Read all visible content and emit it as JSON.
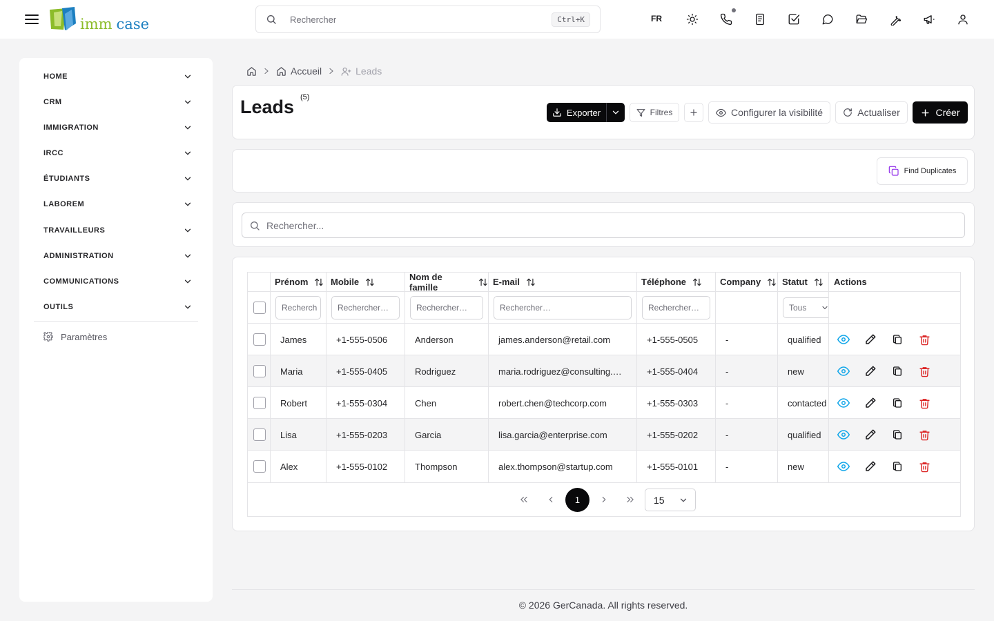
{
  "app": {
    "logo_text_1": "imm",
    "logo_text_2": "case"
  },
  "topbar": {
    "search_placeholder": "Rechercher",
    "shortcut": "Ctrl+K",
    "language": "FR",
    "icons": [
      "sun-icon",
      "phone-icon",
      "notebook-icon",
      "check-square-icon",
      "chat-icon",
      "folder-open-icon",
      "wrench-icon",
      "megaphone-icon",
      "user-icon"
    ]
  },
  "sidebar": {
    "items": [
      {
        "label": "HOME"
      },
      {
        "label": "CRM"
      },
      {
        "label": "IMMIGRATION"
      },
      {
        "label": "IRCC"
      },
      {
        "label": "ÉTUDIANTS"
      },
      {
        "label": "LABOREM"
      },
      {
        "label": "TRAVAILLEURS"
      },
      {
        "label": "ADMINISTRATION"
      },
      {
        "label": "COMMUNICATIONS"
      },
      {
        "label": "OUTILS"
      }
    ],
    "settings_label": "Paramètres"
  },
  "breadcrumb": {
    "home": "Accueil",
    "current": "Leads"
  },
  "header": {
    "title": "Leads",
    "count": "(5)",
    "export_label": "Exporter",
    "filters_label": "Filtres",
    "visibility_label": "Configurer la visibilité",
    "refresh_label": "Actualiser",
    "create_label": "Créer"
  },
  "duplicates": {
    "label": "Find Duplicates"
  },
  "search": {
    "placeholder": "Rechercher..."
  },
  "table": {
    "columns": [
      {
        "label": "Prénom",
        "filter": "Recherch"
      },
      {
        "label": "Mobile",
        "filter": "Rechercher…"
      },
      {
        "label": "Nom de famille",
        "filter": "Rechercher…"
      },
      {
        "label": "E-mail",
        "filter": "Rechercher…"
      },
      {
        "label": "Téléphone",
        "filter": "Rechercher…"
      },
      {
        "label": "Company",
        "filter": ""
      },
      {
        "label": "Statut",
        "filter": "Tous"
      },
      {
        "label": "Actions",
        "filter": ""
      }
    ],
    "rows": [
      {
        "first": "James",
        "mobile": "+1-555-0506",
        "last": "Anderson",
        "email": "james.anderson@retail.com",
        "phone": "+1-555-0505",
        "company": "-",
        "status": "qualified"
      },
      {
        "first": "Maria",
        "mobile": "+1-555-0405",
        "last": "Rodriguez",
        "email": "maria.rodriguez@consulting.…",
        "phone": "+1-555-0404",
        "company": "-",
        "status": "new"
      },
      {
        "first": "Robert",
        "mobile": "+1-555-0304",
        "last": "Chen",
        "email": "robert.chen@techcorp.com",
        "phone": "+1-555-0303",
        "company": "-",
        "status": "contacted"
      },
      {
        "first": "Lisa",
        "mobile": "+1-555-0203",
        "last": "Garcia",
        "email": "lisa.garcia@enterprise.com",
        "phone": "+1-555-0202",
        "company": "-",
        "status": "qualified"
      },
      {
        "first": "Alex",
        "mobile": "+1-555-0102",
        "last": "Thompson",
        "email": "alex.thompson@startup.com",
        "phone": "+1-555-0101",
        "company": "-",
        "status": "new"
      }
    ],
    "pagination": {
      "current_page": "1",
      "page_size": "15"
    }
  },
  "footer": {
    "text": "© 2026 GerCanada. All rights reserved."
  },
  "colors": {
    "accent": "#09090b",
    "view": "#0ea5e9",
    "delete": "#dc2626",
    "duplicates": "#9333ea"
  }
}
